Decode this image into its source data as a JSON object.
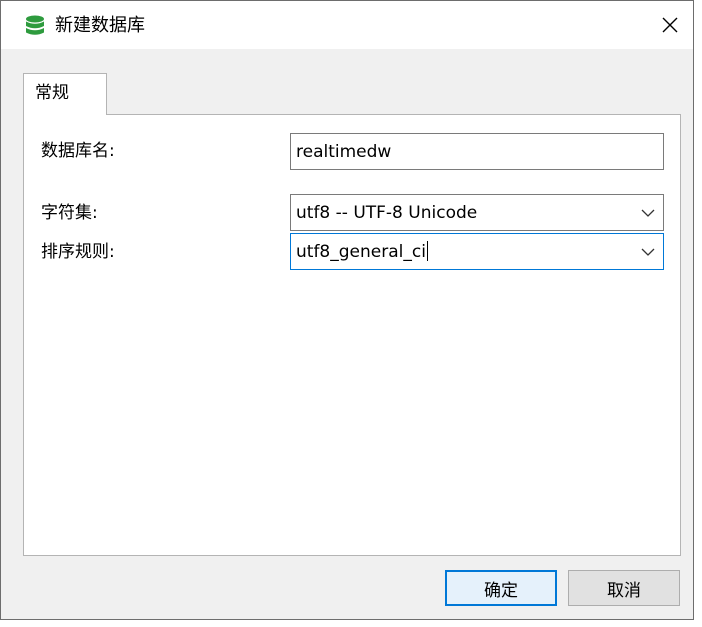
{
  "window": {
    "title": "新建数据库",
    "icon": "database-icon",
    "close_label": "×"
  },
  "tabs": [
    {
      "label": "常规",
      "active": true
    }
  ],
  "form": {
    "db_name": {
      "label": "数据库名:",
      "value": "realtimedw"
    },
    "charset": {
      "label": "字符集:",
      "value": "utf8 -- UTF-8 Unicode"
    },
    "collation": {
      "label": "排序规则:",
      "value": "utf8_general_ci",
      "focused": true
    }
  },
  "buttons": {
    "ok_label": "确定",
    "cancel_label": "取消"
  },
  "colors": {
    "accent": "#0078d7",
    "icon_green": "#2e9b3e"
  }
}
